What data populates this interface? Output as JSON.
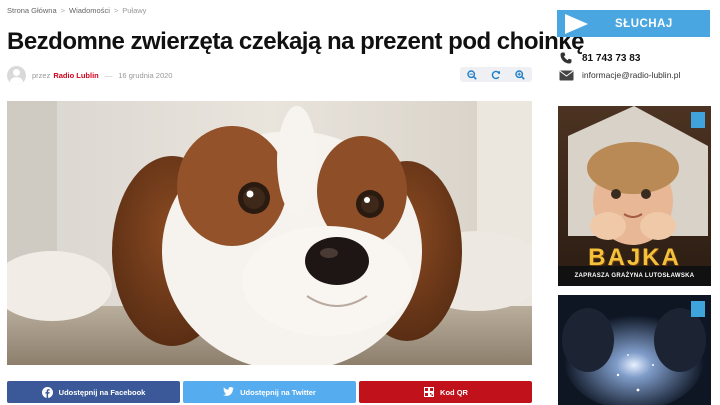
{
  "breadcrumb": {
    "items": [
      "Strona Główna",
      "Wiadomości",
      "Puławy"
    ],
    "separator": ">"
  },
  "article": {
    "title": "Bezdomne zwierzęta czekają na prezent pod choinkę",
    "by_prefix": "przez",
    "author": "Radio Lublin",
    "dash": "—",
    "date": "16 grudnia 2020"
  },
  "tools": {
    "zoom_in_icon": "zoom-in-icon",
    "refresh_icon": "refresh-icon",
    "zoom_out_icon": "zoom-out-icon",
    "color": "#1f7ec9"
  },
  "share": {
    "facebook_label": "Udostępnij na Facebook",
    "twitter_label": "Udostępnij na Twitter",
    "qr_label": "Kod QR",
    "colors": {
      "facebook": "#3b5998",
      "twitter": "#55acee",
      "qr": "#c1121b"
    }
  },
  "sidebar": {
    "listen_label": "SŁUCHAJ",
    "listen_color": "#4aa6e0",
    "phone": "81 743 73 83",
    "email": "informacje@radio-lublin.pl",
    "ad1_title": "BAJKA",
    "ad1_subtitle": "ZAPRASZA GRAŻYNA LUTOSŁAWSKA"
  }
}
